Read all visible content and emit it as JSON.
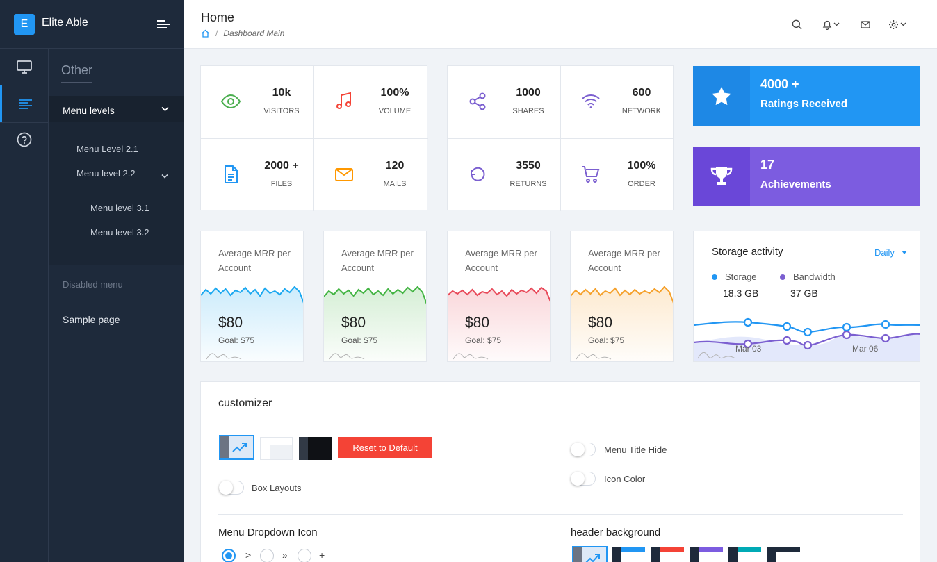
{
  "brand": {
    "logo_letter": "E",
    "name": "Elite Able"
  },
  "subnav": {
    "title": "Other",
    "menu_levels": "Menu levels",
    "level2_1": "Menu Level 2.1",
    "level2_2": "Menu level 2.2",
    "level3_1": "Menu level 3.1",
    "level3_2": "Menu level 3.2",
    "disabled": "Disabled menu",
    "sample": "Sample page"
  },
  "header": {
    "title": "Home",
    "breadcrumb_sep": "/",
    "breadcrumb_current": "Dashboard Main"
  },
  "stats": [
    {
      "value": "10k",
      "label": "VISITORS",
      "icon": "eye-icon",
      "color": "#4caf50"
    },
    {
      "value": "100%",
      "label": "VOLUME",
      "icon": "music-icon",
      "color": "#f44336"
    },
    {
      "value": "2000 +",
      "label": "FILES",
      "icon": "file-icon",
      "color": "#2196f3"
    },
    {
      "value": "120",
      "label": "MAILS",
      "icon": "mail-icon",
      "color": "#ff9800"
    },
    {
      "value": "1000",
      "label": "SHARES",
      "icon": "share-icon",
      "color": "#7b5fd0"
    },
    {
      "value": "600",
      "label": "NETWORK",
      "icon": "wifi-icon",
      "color": "#7b5fd0"
    },
    {
      "value": "3550",
      "label": "RETURNS",
      "icon": "refresh-icon",
      "color": "#7b5fd0"
    },
    {
      "value": "100%",
      "label": "ORDER",
      "icon": "cart-icon",
      "color": "#7b5fd0"
    }
  ],
  "promos": [
    {
      "value": "4000 +",
      "label": "Ratings Received",
      "icon": "star-icon",
      "color": "#2196f3",
      "dark": "#1e88e5"
    },
    {
      "value": "17",
      "label": "Achievements",
      "icon": "trophy-icon",
      "color": "#7c5ce0",
      "dark": "#6a47d8"
    }
  ],
  "mrr_cards": [
    {
      "title": "Average MRR per Account",
      "amount": "$80",
      "goal": "Goal: $75",
      "color": "#1ba8f0"
    },
    {
      "title": "Average MRR per Account",
      "amount": "$80",
      "goal": "Goal: $75",
      "color": "#43b443"
    },
    {
      "title": "Average MRR per Account",
      "amount": "$80",
      "goal": "Goal: $75",
      "color": "#e84a5a"
    },
    {
      "title": "Average MRR per Account",
      "amount": "$80",
      "goal": "Goal: $75",
      "color": "#f5a02a"
    }
  ],
  "storage": {
    "title": "Storage activity",
    "period": "Daily",
    "legend": [
      {
        "name": "Storage",
        "value": "18.3 GB",
        "color": "#2196f3"
      },
      {
        "name": "Bandwidth",
        "value": "37 GB",
        "color": "#7b5fd0"
      }
    ],
    "x_labels": [
      "Mar 03",
      "Mar 06"
    ]
  },
  "customizer": {
    "title": "customizer",
    "reset_label": "Reset to Default",
    "box_layouts": "Box Layouts",
    "menu_title_hide": "Menu Title Hide",
    "icon_color": "Icon Color",
    "dropdown_icon_title": "Menu Dropdown Icon",
    "dropdown_icons": [
      ">",
      "»",
      "+"
    ],
    "header_bg_title": "header background",
    "accent": "#f44336"
  }
}
